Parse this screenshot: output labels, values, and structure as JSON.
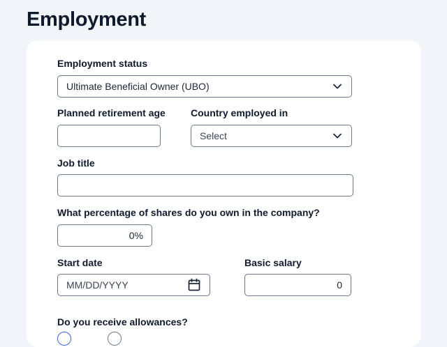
{
  "page": {
    "title": "Employment"
  },
  "form": {
    "employment_status": {
      "label": "Employment status",
      "value": "Ultimate Beneficial Owner (UBO)"
    },
    "retirement_age": {
      "label": "Planned retirement age",
      "value": ""
    },
    "country_employed": {
      "label": "Country employed in",
      "value": "Select"
    },
    "job_title": {
      "label": "Job title",
      "value": ""
    },
    "shares": {
      "label": "What percentage of shares do you own in the company?",
      "value": "0%"
    },
    "start_date": {
      "label": "Start date",
      "placeholder": "MM/DD/YYYY"
    },
    "basic_salary": {
      "label": "Basic salary",
      "value": "0"
    },
    "allowances": {
      "label": "Do you receive allowances?"
    }
  },
  "icons": {
    "chevron": "chevron-down-icon",
    "calendar": "calendar-icon"
  },
  "colors": {
    "background": "#f1f4f8",
    "card": "#ffffff",
    "border": "#6b7a90",
    "text": "#0f1b2d",
    "accent": "#3a64d8"
  }
}
